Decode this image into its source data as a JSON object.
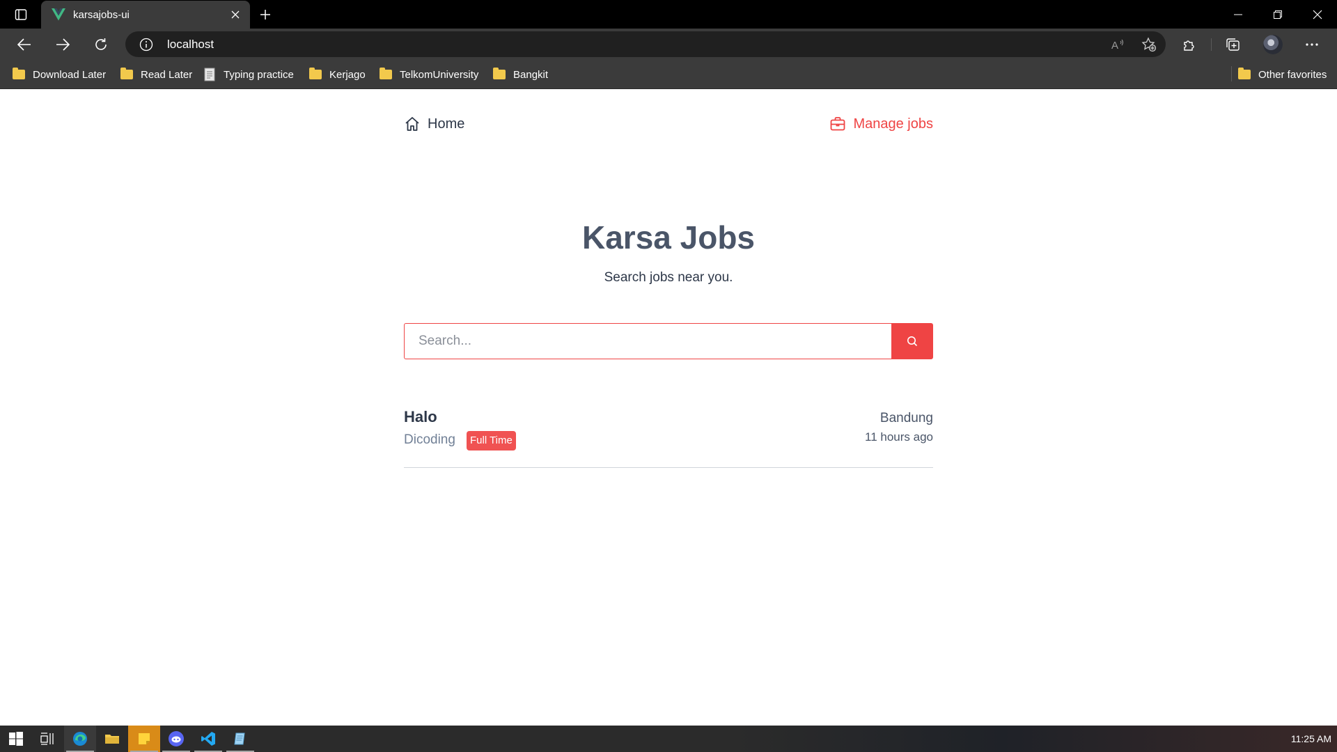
{
  "browser": {
    "tab_title": "karsajobs-ui",
    "address": "localhost",
    "bookmarks": [
      "Download Later",
      "Read Later",
      "Typing practice",
      "Kerjago",
      "TelkomUniversity",
      "Bangkit"
    ],
    "other_favorites": "Other favorites"
  },
  "nav": {
    "home": "Home",
    "manage": "Manage jobs"
  },
  "hero": {
    "title": "Karsa Jobs",
    "subtitle": "Search jobs near you."
  },
  "search": {
    "placeholder": "Search..."
  },
  "jobs": [
    {
      "title": "Halo",
      "company": "Dicoding",
      "type": "Full Time",
      "location": "Bandung",
      "posted": "11 hours ago"
    }
  ],
  "taskbar": {
    "clock": "11:25 AM"
  },
  "colors": {
    "accent": "#ef4444",
    "heading": "#4a5568",
    "text": "#2d3748"
  }
}
